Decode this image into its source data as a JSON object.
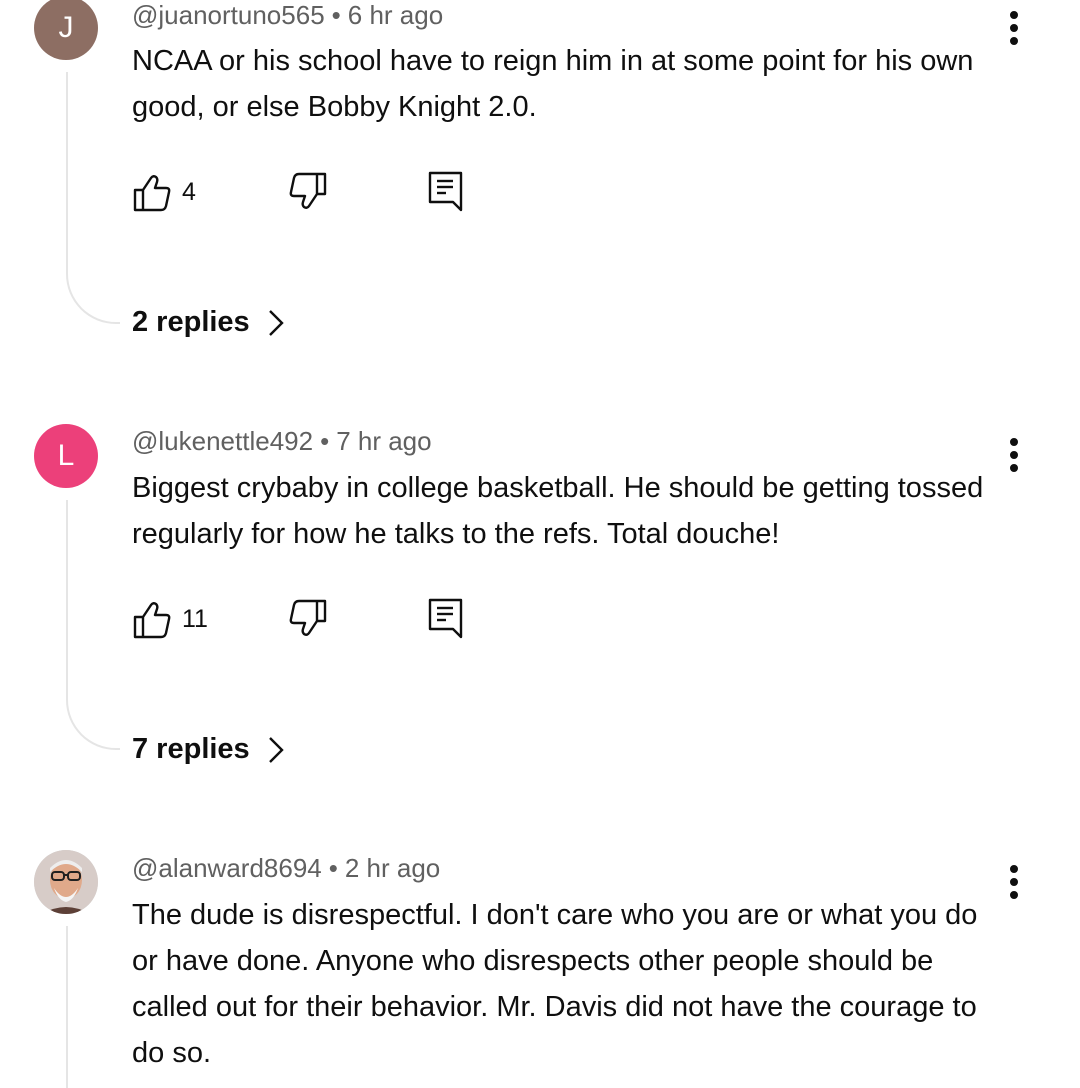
{
  "comments": [
    {
      "avatar_letter": "J",
      "avatar_color": "#8d6e63",
      "handle": "@juanortuno565",
      "separator": "•",
      "time": "6 hr ago",
      "text": "NCAA or his school have to reign him in at some point for his own good, or else Bobby Knight 2.0.",
      "likes": "4",
      "replies_label": "2 replies"
    },
    {
      "avatar_letter": "L",
      "avatar_color": "#ec407a",
      "handle": "@lukenettle492",
      "separator": "•",
      "time": "7 hr ago",
      "text": "Biggest crybaby in college basketball. He should be getting tossed regularly for how he talks to the refs. Total douche!",
      "likes": "11",
      "replies_label": "7 replies"
    },
    {
      "avatar_letter": "",
      "avatar_color": "#cfd8dc",
      "handle": "@alanward8694",
      "separator": "•",
      "time": "2 hr ago",
      "text": "The dude is disrespectful. I don't care who you are or what you do or have done. Anyone who disrespects other people should be called out for their behavior. Mr. Davis did not have the courage to do so."
    }
  ],
  "icons": {
    "like": "thumb-up-icon",
    "dislike": "thumb-down-icon",
    "reply": "reply-comment-icon",
    "more": "more-vertical-icon",
    "chevron": "chevron-right-icon"
  }
}
